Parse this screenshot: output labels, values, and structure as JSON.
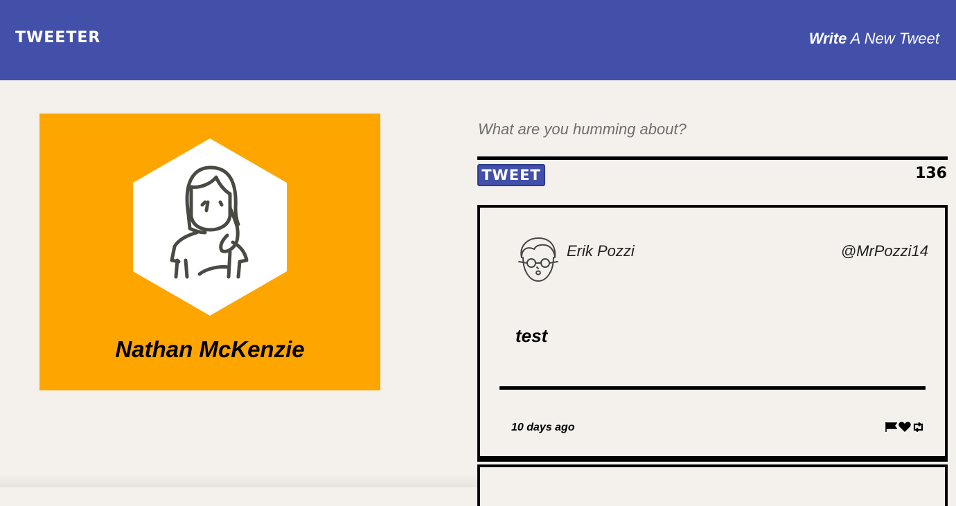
{
  "nav": {
    "brand": "TWEETER",
    "write_bold": "Write",
    "write_rest": " A New Tweet"
  },
  "profile": {
    "name": "Nathan McKenzie",
    "background_color": "#ffa500",
    "avatar_icon": "woman-avatar-icon"
  },
  "compose": {
    "placeholder": "What are you humming about?",
    "button_label": "TWEET",
    "counter": "136"
  },
  "tweets": [
    {
      "author": "Erik Pozzi",
      "handle": "@MrPozzi14",
      "body": "test",
      "time": "10 days ago",
      "avatar_icon": "man-with-glasses-avatar-icon",
      "actions": [
        "flag-icon",
        "heart-icon",
        "retweet-icon"
      ]
    }
  ],
  "colors": {
    "nav": "#4350aa",
    "background": "#f4f1ec",
    "accent": "#ffa500"
  }
}
